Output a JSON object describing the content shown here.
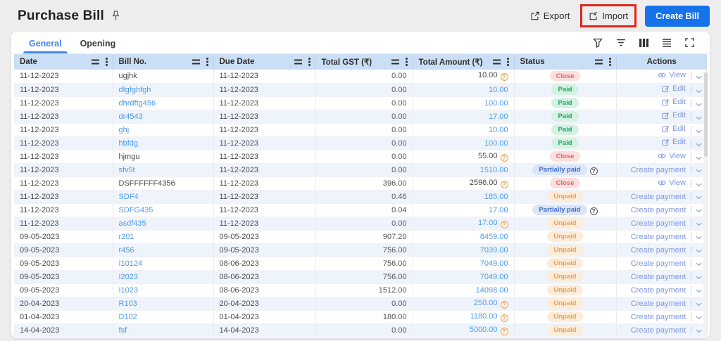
{
  "page": {
    "title": "Purchase Bill"
  },
  "header": {
    "export_label": "Export",
    "import_label": "Import",
    "create_label": "Create Bill",
    "icons": [
      "export-icon",
      "import-icon",
      "pin-icon"
    ],
    "annotation_color": "#e2241b",
    "create_button_color": "#1572e8"
  },
  "tabs": [
    {
      "label": "General",
      "active": true
    },
    {
      "label": "Opening",
      "active": false
    }
  ],
  "toolbar_icons": [
    "filter-funnel-icon",
    "filter-lines-icon",
    "columns-icon",
    "row-density-icon",
    "fullscreen-icon"
  ],
  "colors": {
    "tab_active": "#4285f4",
    "table_header_bg": "#cadef5",
    "alt_row_bg": "#eff4fc",
    "link_blue": "#4d9be8",
    "action_blue": "#7f97e2",
    "status_close": "#ee6161",
    "status_paid": "#23a463",
    "status_partial": "#3d6cc9",
    "status_unpaid": "#f0a04e"
  },
  "table": {
    "columns": [
      "Date",
      "Bill No.",
      "Due Date",
      "Total GST (₹)",
      "Total Amount (₹)",
      "Status",
      "Actions"
    ],
    "rows": [
      {
        "date": "11-12-2023",
        "bill": "ugjhk",
        "bill_link": false,
        "due": "11-12-2023",
        "gst": "0.00",
        "amount": "10.00",
        "amount_link": false,
        "amount_flag": true,
        "status": "Close",
        "status_flag": false,
        "action": "View"
      },
      {
        "date": "11-12-2023",
        "bill": "dfgfghfgh",
        "bill_link": true,
        "due": "11-12-2023",
        "gst": "0.00",
        "amount": "10.00",
        "amount_link": true,
        "amount_flag": false,
        "status": "Paid",
        "status_flag": false,
        "action": "Edit"
      },
      {
        "date": "11-12-2023",
        "bill": "dhrdftg456",
        "bill_link": true,
        "due": "11-12-2023",
        "gst": "0.00",
        "amount": "100.00",
        "amount_link": true,
        "amount_flag": false,
        "status": "Paid",
        "status_flag": false,
        "action": "Edit"
      },
      {
        "date": "11-12-2023",
        "bill": "dr4543",
        "bill_link": true,
        "due": "11-12-2023",
        "gst": "0.00",
        "amount": "17.00",
        "amount_link": true,
        "amount_flag": false,
        "status": "Paid",
        "status_flag": false,
        "action": "Edit"
      },
      {
        "date": "11-12-2023",
        "bill": "ghj",
        "bill_link": true,
        "due": "11-12-2023",
        "gst": "0.00",
        "amount": "10.00",
        "amount_link": true,
        "amount_flag": false,
        "status": "Paid",
        "status_flag": false,
        "action": "Edit"
      },
      {
        "date": "11-12-2023",
        "bill": "hbfdg",
        "bill_link": true,
        "due": "11-12-2023",
        "gst": "0.00",
        "amount": "100.00",
        "amount_link": true,
        "amount_flag": false,
        "status": "Paid",
        "status_flag": false,
        "action": "Edit"
      },
      {
        "date": "11-12-2023",
        "bill": "hjmgu",
        "bill_link": false,
        "due": "11-12-2023",
        "gst": "0.00",
        "amount": "55.00",
        "amount_link": false,
        "amount_flag": true,
        "status": "Close",
        "status_flag": false,
        "action": "View"
      },
      {
        "date": "11-12-2023",
        "bill": "sfv5t",
        "bill_link": true,
        "due": "11-12-2023",
        "gst": "0.00",
        "amount": "1510.00",
        "amount_link": true,
        "amount_flag": false,
        "status": "Partially paid",
        "status_flag": true,
        "action": "Create payment"
      },
      {
        "date": "11-12-2023",
        "bill": "DSFFFFFF4356",
        "bill_link": false,
        "due": "11-12-2023",
        "gst": "396.00",
        "amount": "2596.00",
        "amount_link": false,
        "amount_flag": true,
        "status": "Close",
        "status_flag": false,
        "action": "View"
      },
      {
        "date": "11-12-2023",
        "bill": "SDF4",
        "bill_link": true,
        "due": "11-12-2023",
        "gst": "0.46",
        "amount": "185.00",
        "amount_link": true,
        "amount_flag": false,
        "status": "Unpaid",
        "status_flag": false,
        "action": "Create payment"
      },
      {
        "date": "11-12-2023",
        "bill": "SDFG435",
        "bill_link": true,
        "due": "11-12-2023",
        "gst": "0.04",
        "amount": "17.00",
        "amount_link": true,
        "amount_flag": false,
        "status": "Partially paid",
        "status_flag": true,
        "action": "Create payment"
      },
      {
        "date": "11-12-2023",
        "bill": "asdf435",
        "bill_link": true,
        "due": "11-12-2023",
        "gst": "0.00",
        "amount": "17.00",
        "amount_link": true,
        "amount_flag": true,
        "status": "Unpaid",
        "status_flag": false,
        "action": "Create payment"
      },
      {
        "date": "09-05-2023",
        "bill": "r201",
        "bill_link": true,
        "due": "09-05-2023",
        "gst": "907.20",
        "amount": "8459.00",
        "amount_link": true,
        "amount_flag": false,
        "status": "Unpaid",
        "status_flag": false,
        "action": "Create payment"
      },
      {
        "date": "09-05-2023",
        "bill": "r456",
        "bill_link": true,
        "due": "09-05-2023",
        "gst": "756.00",
        "amount": "7039.00",
        "amount_link": true,
        "amount_flag": false,
        "status": "Unpaid",
        "status_flag": false,
        "action": "Create payment"
      },
      {
        "date": "09-05-2023",
        "bill": "I10124",
        "bill_link": true,
        "due": "08-06-2023",
        "gst": "756.00",
        "amount": "7049.00",
        "amount_link": true,
        "amount_flag": false,
        "status": "Unpaid",
        "status_flag": false,
        "action": "Create payment"
      },
      {
        "date": "09-05-2023",
        "bill": "I2023",
        "bill_link": true,
        "due": "08-06-2023",
        "gst": "756.00",
        "amount": "7049.00",
        "amount_link": true,
        "amount_flag": false,
        "status": "Unpaid",
        "status_flag": false,
        "action": "Create payment"
      },
      {
        "date": "09-05-2023",
        "bill": "I1023",
        "bill_link": true,
        "due": "08-06-2023",
        "gst": "1512.00",
        "amount": "14098.00",
        "amount_link": true,
        "amount_flag": false,
        "status": "Unpaid",
        "status_flag": false,
        "action": "Create payment"
      },
      {
        "date": "20-04-2023",
        "bill": "R103",
        "bill_link": true,
        "due": "20-04-2023",
        "gst": "0.00",
        "amount": "250.00",
        "amount_link": true,
        "amount_flag": true,
        "status": "Unpaid",
        "status_flag": false,
        "action": "Create payment"
      },
      {
        "date": "01-04-2023",
        "bill": "D102",
        "bill_link": true,
        "due": "01-04-2023",
        "gst": "180.00",
        "amount": "1180.00",
        "amount_link": true,
        "amount_flag": true,
        "status": "Unpaid",
        "status_flag": false,
        "action": "Create payment"
      },
      {
        "date": "14-04-2023",
        "bill": "fsf",
        "bill_link": true,
        "due": "14-04-2023",
        "gst": "0.00",
        "amount": "5000.00",
        "amount_link": true,
        "amount_flag": true,
        "status": "Unpaid",
        "status_flag": false,
        "action": "Create payment"
      }
    ]
  }
}
